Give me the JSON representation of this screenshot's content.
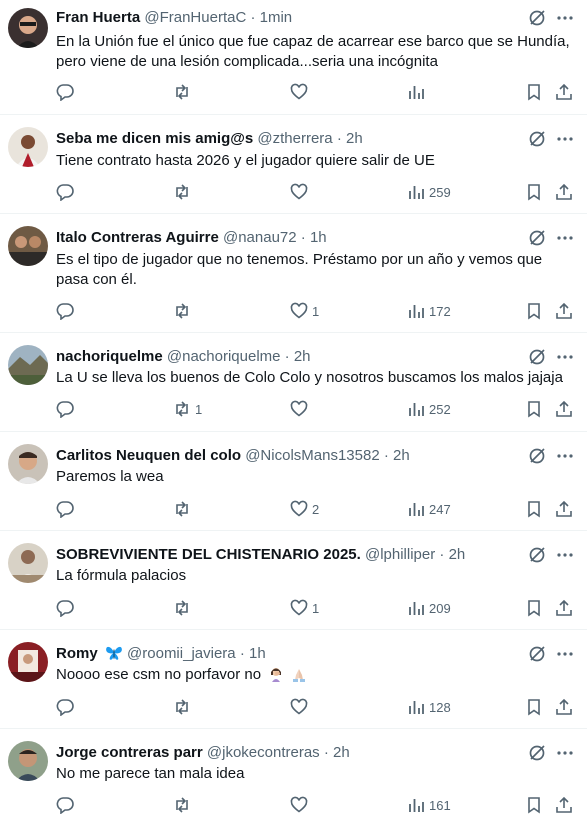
{
  "icons": {
    "reply": "reply-icon",
    "retweet": "retweet-icon",
    "like": "heart-icon",
    "views": "views-icon",
    "bookmark": "bookmark-icon",
    "share": "share-icon",
    "grok": "grok-icon",
    "more": "more-icon"
  },
  "colors": {
    "text": "#0f1419",
    "muted": "#536471",
    "divider": "#eff3f4",
    "butterfly": "#1d9bf0"
  },
  "tweets": [
    {
      "name": "Fran Huerta",
      "handle": "@FranHuertaC",
      "time": "1min",
      "text": "En la Unión fue el único que fue capaz de acarrear ese barco que se Hundía, pero viene de una lesión complicada...seria una incógnita",
      "replies": "",
      "retweets": "",
      "likes": "",
      "views": ""
    },
    {
      "name": "Seba me dicen mis amig@s",
      "handle": "@ztherrera",
      "time": "2h",
      "text": "Tiene contrato hasta 2026 y el jugador quiere salir de UE",
      "replies": "",
      "retweets": "",
      "likes": "",
      "views": "259"
    },
    {
      "name": "Italo Contreras Aguirre",
      "handle": "@nanau72",
      "time": "1h",
      "text": "Es el tipo de jugador que no tenemos. Préstamo por un año y vemos que pasa con él.",
      "replies": "",
      "retweets": "",
      "likes": "1",
      "views": "172"
    },
    {
      "name": "nachoriquelme",
      "handle": "@nachoriquelme",
      "time": "2h",
      "text": "La U se lleva los buenos de Colo Colo y nosotros buscamos los malos jajaja",
      "replies": "",
      "retweets": "1",
      "likes": "",
      "views": "252"
    },
    {
      "name": "Carlitos Neuquen del colo",
      "handle": "@NicolsMans13582",
      "time": "2h",
      "text": "Paremos la wea",
      "replies": "",
      "retweets": "",
      "likes": "2",
      "views": "247"
    },
    {
      "name": "SOBREVIVIENTE DEL CHISTENARIO 2025.",
      "handle": "@lphilliper",
      "time": "2h",
      "text": "La fórmula palacios",
      "replies": "",
      "retweets": "",
      "likes": "1",
      "views": "209"
    },
    {
      "name": "Romy",
      "handle": "@roomii_javiera",
      "time": "1h",
      "text": "Noooo ese csm no porfavor no",
      "name_emoji": "butterfly-emoji",
      "text_emojis": [
        "woman-facepalming-emoji",
        "folded-hands-emoji"
      ],
      "replies": "",
      "retweets": "",
      "likes": "",
      "views": "128"
    },
    {
      "name": "Jorge contreras parr",
      "handle": "@jkokecontreras",
      "time": "2h",
      "text": "No me parece tan mala idea",
      "replies": "",
      "retweets": "",
      "likes": "",
      "views": "161"
    }
  ]
}
